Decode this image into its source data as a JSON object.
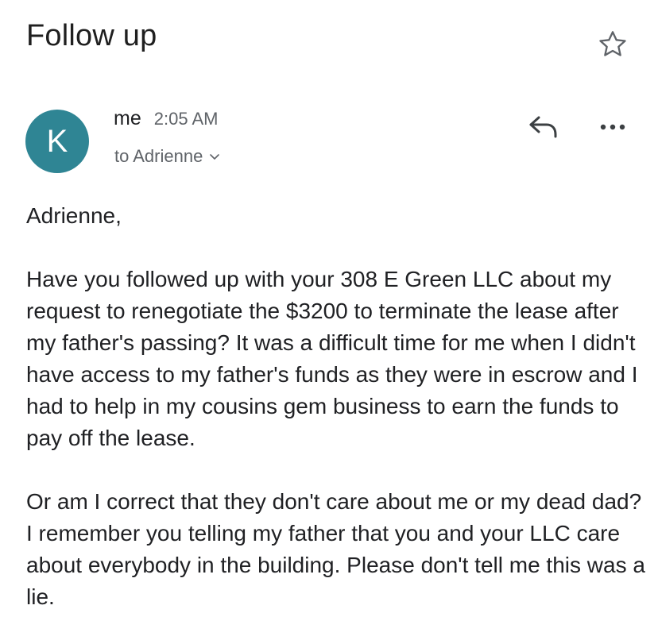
{
  "email": {
    "subject": "Follow up",
    "avatar_letter": "K",
    "sender": "me",
    "time": "2:05 AM",
    "recipient": "to Adrienne",
    "body": {
      "greeting": "Adrienne,",
      "paragraph_1": "Have you followed up with your 308 E Green LLC about my request to renegotiate the $3200 to terminate the lease after my father's passing? It was a difficult time for me when I didn't have access to my father's funds as they were in escrow and I had to help in my cousins gem business to earn the funds to pay off the lease.",
      "paragraph_2": "Or am I correct that they don't care about me or my dead dad? I remember you telling my father that you and your LLC care about everybody in the building. Please don't tell me this was a lie."
    }
  },
  "icons": {
    "star": "star-outline-icon",
    "reply": "reply-icon",
    "more": "more-horizontal-icon",
    "recipient_expand": "chevron-down-icon"
  },
  "colors": {
    "avatar_bg": "#2f8594",
    "secondary_text": "#5f6368",
    "primary_text": "#202124"
  }
}
